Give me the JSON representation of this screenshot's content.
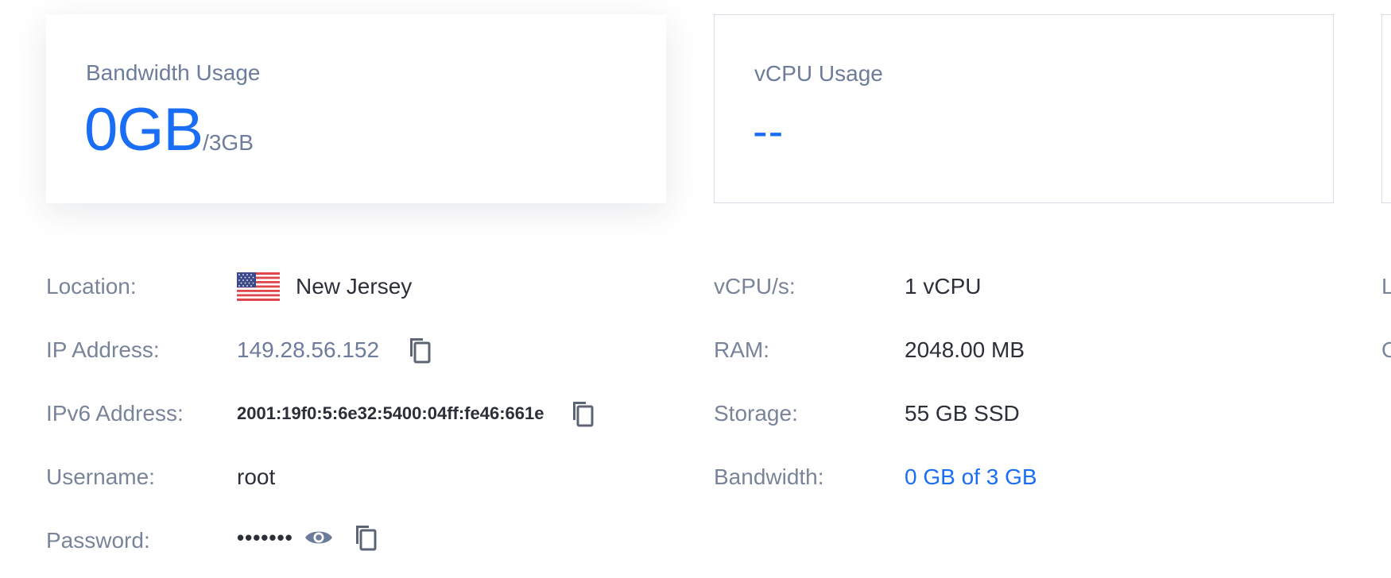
{
  "cards": {
    "bandwidth": {
      "title": "Bandwidth Usage",
      "value": "0GB",
      "unit": "/3GB"
    },
    "vcpu": {
      "title": "vCPU Usage",
      "value": "--"
    }
  },
  "left_details": {
    "location_label": "Location:",
    "location_value": "New Jersey",
    "location_flag": "us-flag-icon",
    "ip_label": "IP Address:",
    "ip_value": "149.28.56.152",
    "ipv6_label": "IPv6 Address:",
    "ipv6_value": "2001:19f0:5:6e32:5400:04ff:fe46:661e",
    "username_label": "Username:",
    "username_value": "root",
    "password_label": "Password:",
    "password_value": "•••••••"
  },
  "right_details": {
    "vcpu_label": "vCPU/s:",
    "vcpu_value": "1 vCPU",
    "ram_label": "RAM:",
    "ram_value": "2048.00 MB",
    "storage_label": "Storage:",
    "storage_value": "55 GB SSD",
    "bandwidth_label": "Bandwidth:",
    "bandwidth_value": "0 GB of 3 GB"
  },
  "third_column_peek": {
    "row1_label": "L",
    "row2_label": "O"
  },
  "icons": {
    "copy": "copy-icon",
    "eye": "eye-icon"
  },
  "colors": {
    "accent": "#1a6ef5",
    "label": "#7a8499",
    "muted": "#6e7c9c",
    "text": "#2b2f38"
  }
}
